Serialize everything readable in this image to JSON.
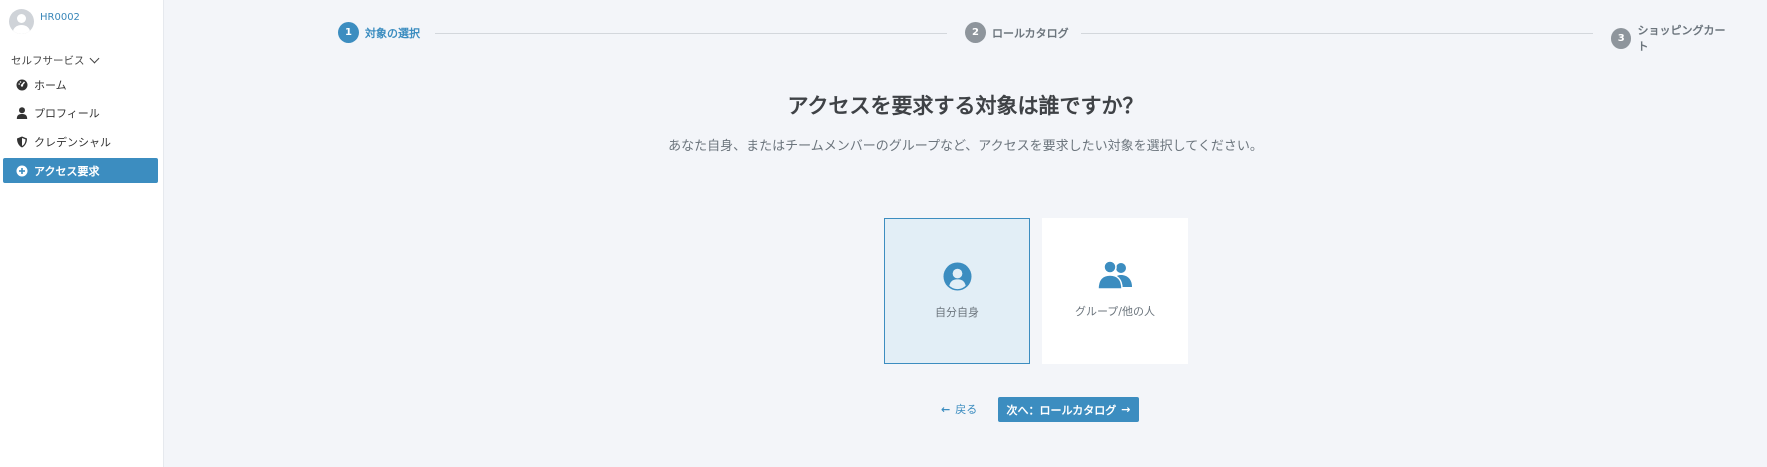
{
  "user": {
    "name": "HR0002"
  },
  "sidebar": {
    "section_label": "セルフサービス",
    "items": [
      {
        "label": "ホーム",
        "icon": "dashboard-icon"
      },
      {
        "label": "プロフィール",
        "icon": "user-icon"
      },
      {
        "label": "クレデンシャル",
        "icon": "shield-icon"
      },
      {
        "label": "アクセス要求",
        "icon": "plus-circle-icon",
        "active": true
      }
    ]
  },
  "stepper": {
    "steps": [
      {
        "number": "1",
        "label": "対象の選択",
        "active": true
      },
      {
        "number": "2",
        "label": "ロールカタログ",
        "active": false
      },
      {
        "number": "3",
        "label": "ショッピングカート",
        "active": false
      }
    ]
  },
  "main": {
    "title": "アクセスを要求する対象は誰ですか？",
    "description": "あなた自身、またはチームメンバーのグループなど、アクセスを要求したい対象を選択してください。",
    "options": [
      {
        "label": "自分自身",
        "icon": "user-circle-icon",
        "selected": true
      },
      {
        "label": "グループ/他の人",
        "icon": "users-icon",
        "selected": false
      }
    ],
    "back_label": "戻る",
    "next_label": "次へ：ロールカタログ"
  },
  "colors": {
    "accent": "#3c8dc0",
    "background": "#f3f5f9",
    "selected_card": "#e2eef6",
    "inactive_step": "#8e959c"
  }
}
